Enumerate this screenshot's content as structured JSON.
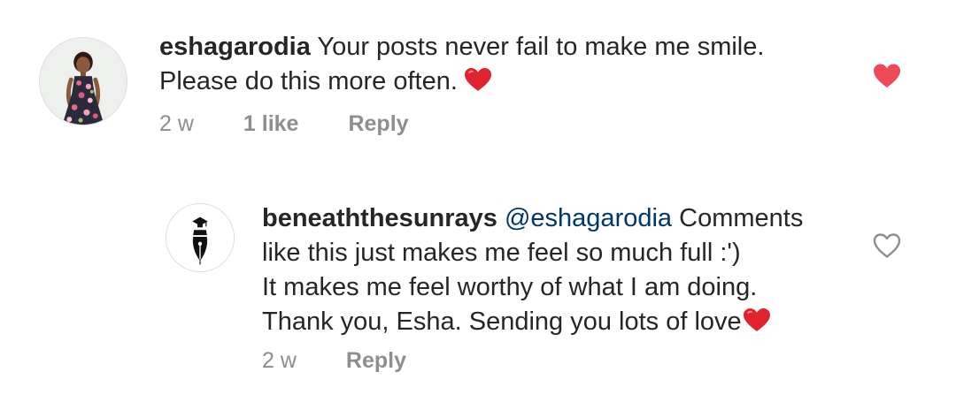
{
  "comments": [
    {
      "username": "eshagarodia",
      "text_lines": [
        "Your posts never fail to make me smile.",
        "Please do this more often."
      ],
      "emoji": "red-heart",
      "time": "2 w",
      "likes": "1 like",
      "reply_label": "Reply",
      "liked": true,
      "avatar": "user-photo-avatar"
    }
  ],
  "reply": {
    "username": "beneaththesunrays",
    "mention": "@eshagarodia",
    "text_after_mention": "Comments",
    "text_lines": [
      "like this just makes me feel so much full :')",
      "It makes me feel worthy of what I am doing.",
      "Thank you, Esha. Sending you lots of love"
    ],
    "emoji": "red-heart",
    "time": "2 w",
    "reply_label": "Reply",
    "liked": false,
    "avatar": "fountain-pen-nib-logo"
  },
  "colors": {
    "heart_red": "#ed4956",
    "secondary_text": "#8e8e8e",
    "primary_text": "#262626",
    "mention": "#00376b"
  }
}
